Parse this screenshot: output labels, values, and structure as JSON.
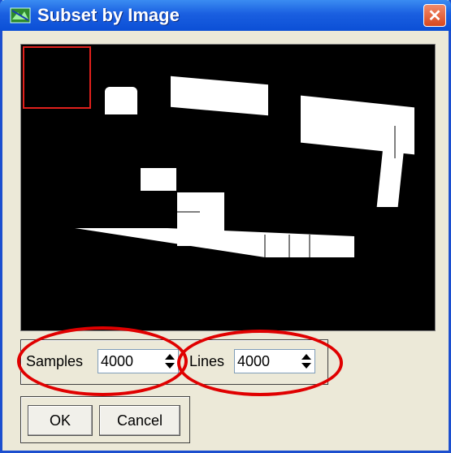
{
  "window": {
    "title": "Subset by Image",
    "close_glyph": "✕"
  },
  "colors": {
    "title_bar": "#1a5fe0",
    "roi_box": "#e0201c",
    "annotation_ellipse": "#e00000"
  },
  "preview": {
    "background": "black image with white shapes"
  },
  "fields": {
    "samples": {
      "label": "Samples",
      "value": "4000"
    },
    "lines": {
      "label": "Lines",
      "value": "4000"
    }
  },
  "buttons": {
    "ok": "OK",
    "cancel": "Cancel"
  },
  "icons": {
    "app": "envi-app-icon",
    "close": "close-icon",
    "spinner": "spinner-arrows-icon"
  }
}
